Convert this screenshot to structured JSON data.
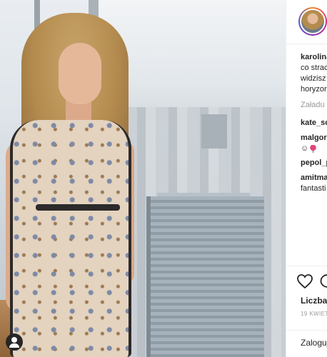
{
  "post": {
    "image_alt": "woman in floral dress by window overlooking city"
  },
  "side": {
    "caption": {
      "username": "karolina",
      "lines": [
        "co strac",
        "widzisz",
        "horyzor"
      ]
    },
    "load_more": "Załadu",
    "comments": [
      {
        "user": "kate_so",
        "text": ""
      },
      {
        "user": "malgor",
        "text": "☺"
      },
      {
        "user": "pepol_p",
        "text": ""
      },
      {
        "user": "amitma",
        "text": "fantasti"
      }
    ],
    "likes_label": "Liczba",
    "date": "19 KWIETN",
    "login": "Zaloguj"
  }
}
